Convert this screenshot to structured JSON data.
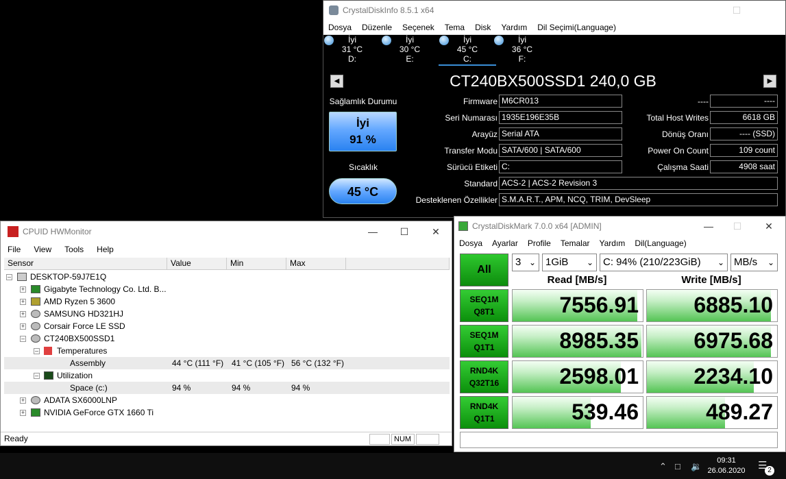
{
  "cdi": {
    "title": "CrystalDiskInfo 8.5.1 x64",
    "menu": [
      "Dosya",
      "Düzenle",
      "Seçenek",
      "Tema",
      "Disk",
      "Yardım",
      "Dil Seçimi(Language)"
    ],
    "disks": [
      {
        "status": "İyi",
        "temp": "31 °C",
        "letter": "D:"
      },
      {
        "status": "İyi",
        "temp": "30 °C",
        "letter": "E:"
      },
      {
        "status": "İyi",
        "temp": "45 °C",
        "letter": "C:"
      },
      {
        "status": "İyi",
        "temp": "36 °C",
        "letter": "F:"
      }
    ],
    "model": "CT240BX500SSD1 240,0 GB",
    "health_label": "Sağlamlık Durumu",
    "health_status": "İyi",
    "health_percent": "91 %",
    "temp_label": "Sıcaklık",
    "temp_value": "45 °C",
    "left_fields": [
      {
        "label": "Firmware",
        "value": "M6CR013"
      },
      {
        "label": "Seri Numarası",
        "value": "1935E196E35B"
      },
      {
        "label": "Arayüz",
        "value": "Serial ATA"
      },
      {
        "label": "Transfer Modu",
        "value": "SATA/600 | SATA/600"
      },
      {
        "label": "Sürücü Etiketi",
        "value": "C:"
      }
    ],
    "right_fields": [
      {
        "label": "----",
        "value": "----"
      },
      {
        "label": "Total Host Writes",
        "value": "6618 GB"
      },
      {
        "label": "Dönüş Oranı",
        "value": "---- (SSD)"
      },
      {
        "label": "Power On Count",
        "value": "109 count"
      },
      {
        "label": "Çalışma Saati",
        "value": "4908 saat"
      }
    ],
    "standard_label": "Standard",
    "standard_value": "ACS-2 | ACS-2 Revision 3",
    "features_label": "Desteklenen Özellikler",
    "features_value": "S.M.A.R.T., APM, NCQ, TRIM, DevSleep"
  },
  "hwm": {
    "title": "CPUID HWMonitor",
    "menu": [
      "File",
      "View",
      "Tools",
      "Help"
    ],
    "columns": [
      "Sensor",
      "Value",
      "Min",
      "Max"
    ],
    "tree": {
      "root": "DESKTOP-59J7E1Q",
      "items": [
        "Gigabyte Technology Co. Ltd. B...",
        "AMD Ryzen 5 3600",
        "SAMSUNG HD321HJ",
        "Corsair Force LE SSD",
        "CT240BX500SSD1"
      ],
      "temperatures": "Temperatures",
      "assembly": {
        "name": "Assembly",
        "value": "44 °C  (111 °F)",
        "min": "41 °C  (105 °F)",
        "max": "56 °C  (132 °F)"
      },
      "utilization": "Utilization",
      "space": {
        "name": "Space (c:)",
        "value": "94 %",
        "min": "94 %",
        "max": "94 %"
      },
      "items_after": [
        "ADATA SX6000LNP",
        "NVIDIA GeForce GTX 1660 Ti"
      ]
    },
    "status": "Ready",
    "num": "NUM"
  },
  "cdm": {
    "title": "CrystalDiskMark 7.0.0 x64 [ADMIN]",
    "menu": [
      "Dosya",
      "Ayarlar",
      "Profile",
      "Temalar",
      "Yardım",
      "Dil(Language)"
    ],
    "all_label": "All",
    "count": "3",
    "size": "1GiB",
    "drive": "C: 94% (210/223GiB)",
    "unit": "MB/s",
    "read_head": "Read [MB/s]",
    "write_head": "Write [MB/s]",
    "tests": [
      {
        "l1": "SEQ1M",
        "l2": "Q8T1",
        "read": "7556.91",
        "write": "6885.10",
        "read_frac": 0.96,
        "write_frac": 0.95
      },
      {
        "l1": "SEQ1M",
        "l2": "Q1T1",
        "read": "8985.35",
        "write": "6975.68",
        "read_frac": 0.99,
        "write_frac": 0.95
      },
      {
        "l1": "RND4K",
        "l2": "Q32T16",
        "read": "2598.01",
        "write": "2234.10",
        "read_frac": 0.83,
        "write_frac": 0.82
      },
      {
        "l1": "RND4K",
        "l2": "Q1T1",
        "read": "539.46",
        "write": "489.27",
        "read_frac": 0.6,
        "write_frac": 0.6
      }
    ]
  },
  "taskbar": {
    "time": "09:31",
    "date": "26.06.2020",
    "notifications": "2"
  }
}
